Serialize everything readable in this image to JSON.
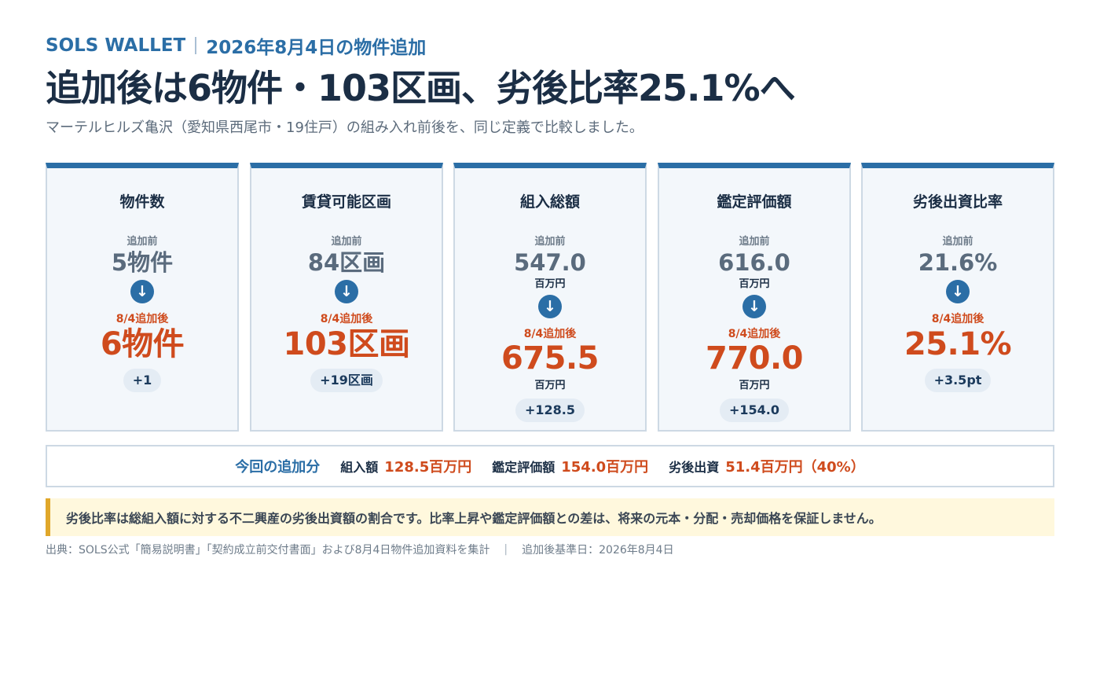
{
  "header": {
    "brand": "SOLS WALLET",
    "kicker": "2026年8月4日の物件追加",
    "headline": "追加後は6物件・103区画、劣後比率25.1%へ",
    "subline": "マーテルヒルズ亀沢（愛知県西尾市・19住戸）の組み入れ前後を、同じ定義で比較しました。"
  },
  "cards": [
    {
      "title": "物件数",
      "before_label": "追加前",
      "before_value": "5物件",
      "after_label": "8/4追加後",
      "after_value": "6物件",
      "delta": "+1"
    },
    {
      "title": "賃貸可能区画",
      "before_label": "追加前",
      "before_value": "84区画",
      "after_label": "8/4追加後",
      "after_value": "103区画",
      "delta": "+19区画"
    },
    {
      "title": "組入総額",
      "before_label": "追加前",
      "before_value": "547.0",
      "before_unit": "百万円",
      "after_label": "8/4追加後",
      "after_value": "675.5",
      "after_unit": "百万円",
      "delta": "+128.5"
    },
    {
      "title": "鑑定評価額",
      "before_label": "追加前",
      "before_value": "616.0",
      "before_unit": "百万円",
      "after_label": "8/4追加後",
      "after_value": "770.0",
      "after_unit": "百万円",
      "delta": "+154.0"
    },
    {
      "title": "劣後出資比率",
      "before_label": "追加前",
      "before_value": "21.6%",
      "after_label": "8/4追加後",
      "after_value": "25.1%",
      "delta": "+3.5pt"
    }
  ],
  "arrow_glyph": "↓",
  "summary": {
    "title": "今回の追加分",
    "items": [
      {
        "label": "組入額",
        "value": "128.5百万円"
      },
      {
        "label": "鑑定評価額",
        "value": "154.0百万円"
      },
      {
        "label": "劣後出資",
        "value": "51.4百万円（40%）"
      }
    ]
  },
  "note": "劣後比率は総組入額に対する不二興産の劣後出資額の割合です。比率上昇や鑑定評価額との差は、将来の元本・分配・売却価格を保証しません。",
  "footer": {
    "source": "出典：SOLS公式「簡易説明書」「契約成立前交付書面」および8月4日物件追加資料を集計",
    "separator": "|",
    "base_date": "追加後基準日：2026年8月4日"
  },
  "colors": {
    "accent_blue": "#2b6ea6",
    "after_orange": "#cf4b1d",
    "note_bar": "#e0a72a"
  }
}
